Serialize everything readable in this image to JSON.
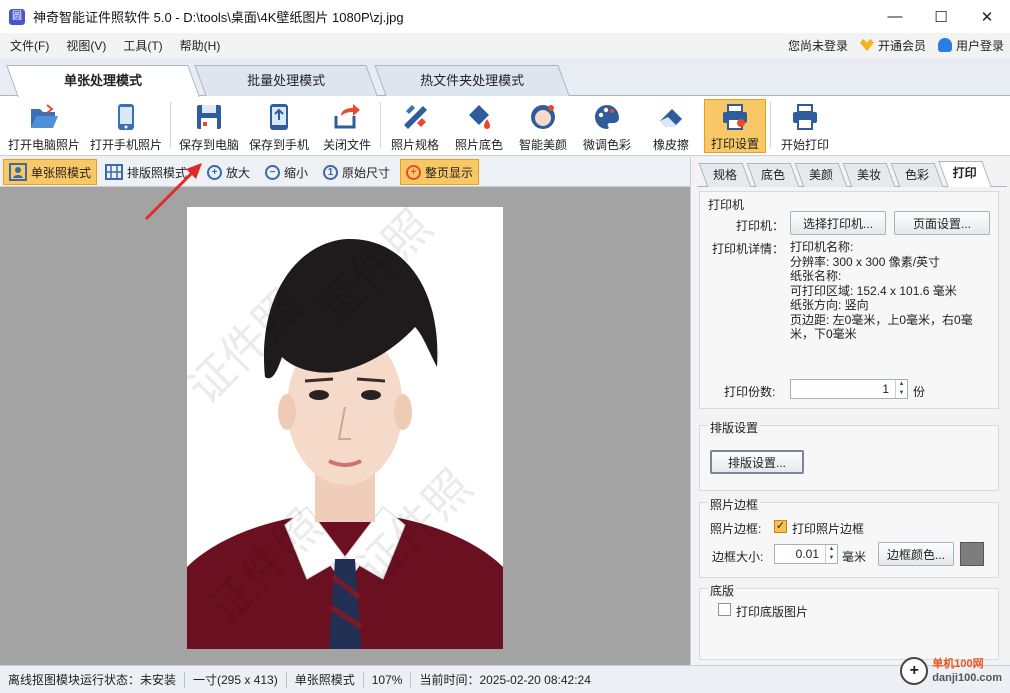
{
  "window": {
    "app_icon_glyph": "圆",
    "title": "神奇智能证件照软件 5.0 - D:\\tools\\桌面\\4K壁纸图片 1080P\\zj.jpg",
    "min_glyph": "—",
    "max_glyph": "☐",
    "close_glyph": "✕"
  },
  "menu": {
    "items": [
      "文件(F)",
      "视图(V)",
      "工具(T)",
      "帮助(H)"
    ],
    "login_status": "您尚未登录",
    "vip": "开通会员",
    "user_login": "用户登录"
  },
  "mode_tabs": [
    "单张处理模式",
    "批量处理模式",
    "热文件夹处理模式"
  ],
  "toolbar": {
    "items": [
      {
        "label": "打开电脑照片",
        "icon": "folder-open-icon"
      },
      {
        "label": "打开手机照片",
        "icon": "phone-icon"
      },
      {
        "label": "保存到电脑",
        "icon": "save-disk-icon"
      },
      {
        "label": "保存到手机",
        "icon": "phone-upload-icon"
      },
      {
        "label": "关闭文件",
        "icon": "close-file-icon"
      },
      {
        "label": "照片规格",
        "icon": "ruler-pen-icon"
      },
      {
        "label": "照片底色",
        "icon": "paint-bucket-icon"
      },
      {
        "label": "智能美颜",
        "icon": "face-beauty-icon"
      },
      {
        "label": "微调色彩",
        "icon": "palette-icon"
      },
      {
        "label": "橡皮擦",
        "icon": "eraser-icon"
      },
      {
        "label": "打印设置",
        "icon": "printer-settings-icon"
      },
      {
        "label": "开始打印",
        "icon": "printer-icon"
      }
    ],
    "active": "打印设置"
  },
  "viewbar": {
    "single": "单张照模式",
    "layout": "排版照模式",
    "zoom_in": "放大",
    "zoom_out": "缩小",
    "original": "原始尺寸",
    "fit": "整页显示"
  },
  "canvas": {
    "watermark": "证件照"
  },
  "right_tabs": [
    "规格",
    "底色",
    "美颜",
    "美妆",
    "色彩",
    "打印"
  ],
  "printer": {
    "group_title": "打印机",
    "printer_label": "打印机：",
    "select_btn": "选择打印机...",
    "page_setup_btn": "页面设置...",
    "details_label": "打印机详情：",
    "details": [
      "打印机名称:",
      "分辨率: 300 x 300 像素/英寸",
      "纸张名称:",
      "可打印区域: 152.4 x 101.6 毫米",
      "纸张方向: 竖向",
      "页边距: 左0毫米，上0毫米，右0毫",
      "米，下0毫米"
    ],
    "copies_label": "打印份数:",
    "copies_value": "1",
    "copies_unit": "份"
  },
  "layout_settings": {
    "group_title": "排版设置",
    "btn": "排版设置..."
  },
  "border": {
    "group_title": "照片边框",
    "label": "照片边框:",
    "checkbox_label": "打印照片边框",
    "checked": true,
    "size_label": "边框大小:",
    "size_value": "0.01",
    "size_unit": "毫米",
    "color_btn": "边框颜色...",
    "color": "#7d7d7d"
  },
  "base": {
    "group_title": "底版",
    "checkbox_label": "打印底版图片",
    "checked": false
  },
  "status": {
    "items": [
      "离线抠图模块运行状态：未安装",
      "一寸(295 x 413)",
      "单张照模式",
      "107%",
      "当前时间：2025-02-20 08:42:24"
    ]
  },
  "watermark_site": {
    "line1": "单机100网",
    "line2": "danji100.com"
  },
  "colors": {
    "accent_active": "#f9c866",
    "arrow_red": "#e02a2a"
  }
}
